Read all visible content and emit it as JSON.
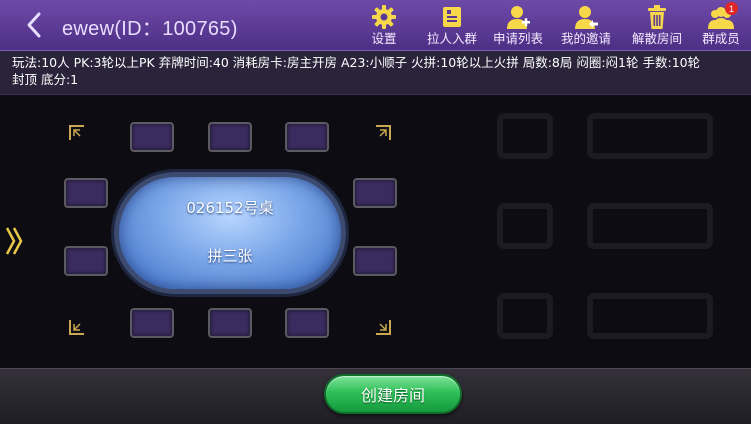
{
  "header": {
    "title": "ewew(ID：100765)",
    "buttons": [
      {
        "label": "设置",
        "icon": "gear-icon"
      },
      {
        "label": "拉人入群",
        "icon": "add-to-group-icon"
      },
      {
        "label": "申请列表",
        "icon": "apply-list-icon"
      },
      {
        "label": "我的邀请",
        "icon": "my-invite-icon"
      },
      {
        "label": "解散房间",
        "icon": "trash-icon"
      },
      {
        "label": "群成员",
        "icon": "group-members-icon",
        "badge": "1"
      }
    ]
  },
  "rules": {
    "line1": "玩法:10人 PK:3轮以上PK 弃牌时间:40 消耗房卡:房主开房 A23:小顺子 火拼:10轮以上火拼 局数:8局 闷圈:闷1轮 手数:10轮",
    "line2": "封顶 底分:1"
  },
  "table": {
    "name": "026152号桌",
    "game": "拼三张",
    "seat_count": 10
  },
  "footer": {
    "create_label": "创建房间"
  },
  "colors": {
    "header_bg": "#5a3a95",
    "seat": "#3a2c5e",
    "table": "#7aa6e8",
    "button_green": "#2fbf58",
    "corner_gold": "#c8a850"
  }
}
